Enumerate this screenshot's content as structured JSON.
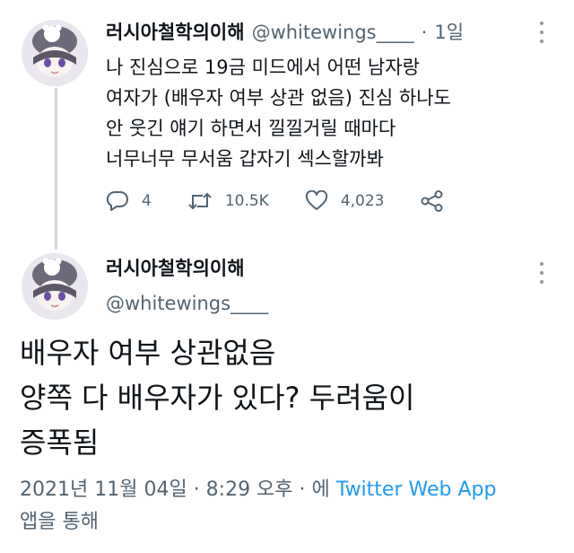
{
  "tweet1": {
    "display_name": "러시아철학의이해",
    "handle": "@whitewings____",
    "separator": "·",
    "time": "1일",
    "lines": [
      "나 진심으로 19금 미드에서 어떤 남자랑",
      "여자가 (배우자 여부 상관 없음) 진심 하나도",
      "안 웃긴 얘기 하면서 낄낄거릴 때마다",
      "너무너무 무서움 갑자기 섹스할까봐"
    ],
    "replies": "4",
    "retweets": "10.5K",
    "likes": "4,023",
    "icons": [
      "reply-icon",
      "retweet-icon",
      "like-icon",
      "share-icon",
      "more-icon"
    ]
  },
  "tweet2": {
    "display_name": "러시아철학의이해",
    "handle": "@whitewings____",
    "lines": [
      "배우자 여부 상관없음",
      "양쪽 다 배우자가 있다? 두려움이",
      "증폭됨"
    ],
    "date_time": "2021년 11월 04일 · 8:29 오후 · 에 ",
    "source": "Twitter Web App",
    "via_suffix": "앱을 통해"
  },
  "colors": {
    "text": "#0f1419",
    "secondary": "#536471",
    "link": "#1d9bf0",
    "thread_line": "#cfd9de"
  }
}
